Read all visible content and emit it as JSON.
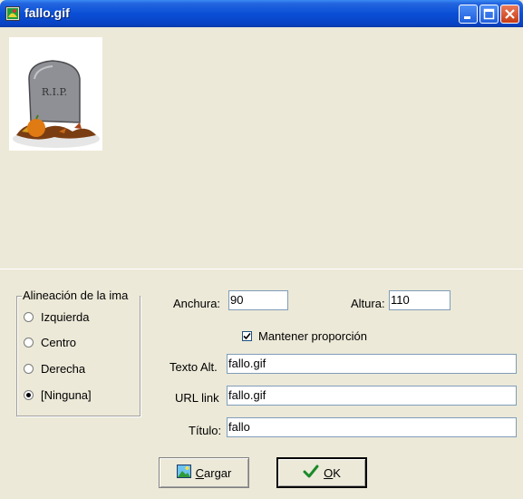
{
  "window": {
    "title": "fallo.gif"
  },
  "preview": {
    "image_text": "R.I.P."
  },
  "alignment": {
    "legend": "Alineación de la ima",
    "options": [
      {
        "label": "Izquierda",
        "selected": false
      },
      {
        "label": "Centro",
        "selected": false
      },
      {
        "label": "Derecha",
        "selected": false
      },
      {
        "label": "[Ninguna]",
        "selected": true
      }
    ]
  },
  "form": {
    "width_label": "Anchura:",
    "width_value": "90",
    "height_label": "Altura:",
    "height_value": "110",
    "keep_ratio_label": "Mantener proporción",
    "keep_ratio_checked": true,
    "alt_label": "Texto Alt.",
    "alt_value": "fallo.gif",
    "url_label": "URL link",
    "url_value": "fallo.gif",
    "title_label": "Título:",
    "title_value": "fallo"
  },
  "buttons": {
    "load_first": "C",
    "load_rest": "argar",
    "ok_first": "O",
    "ok_rest": "K"
  },
  "icons": {
    "app": "image-app-icon",
    "load": "picture-icon",
    "ok": "checkmark-icon"
  }
}
